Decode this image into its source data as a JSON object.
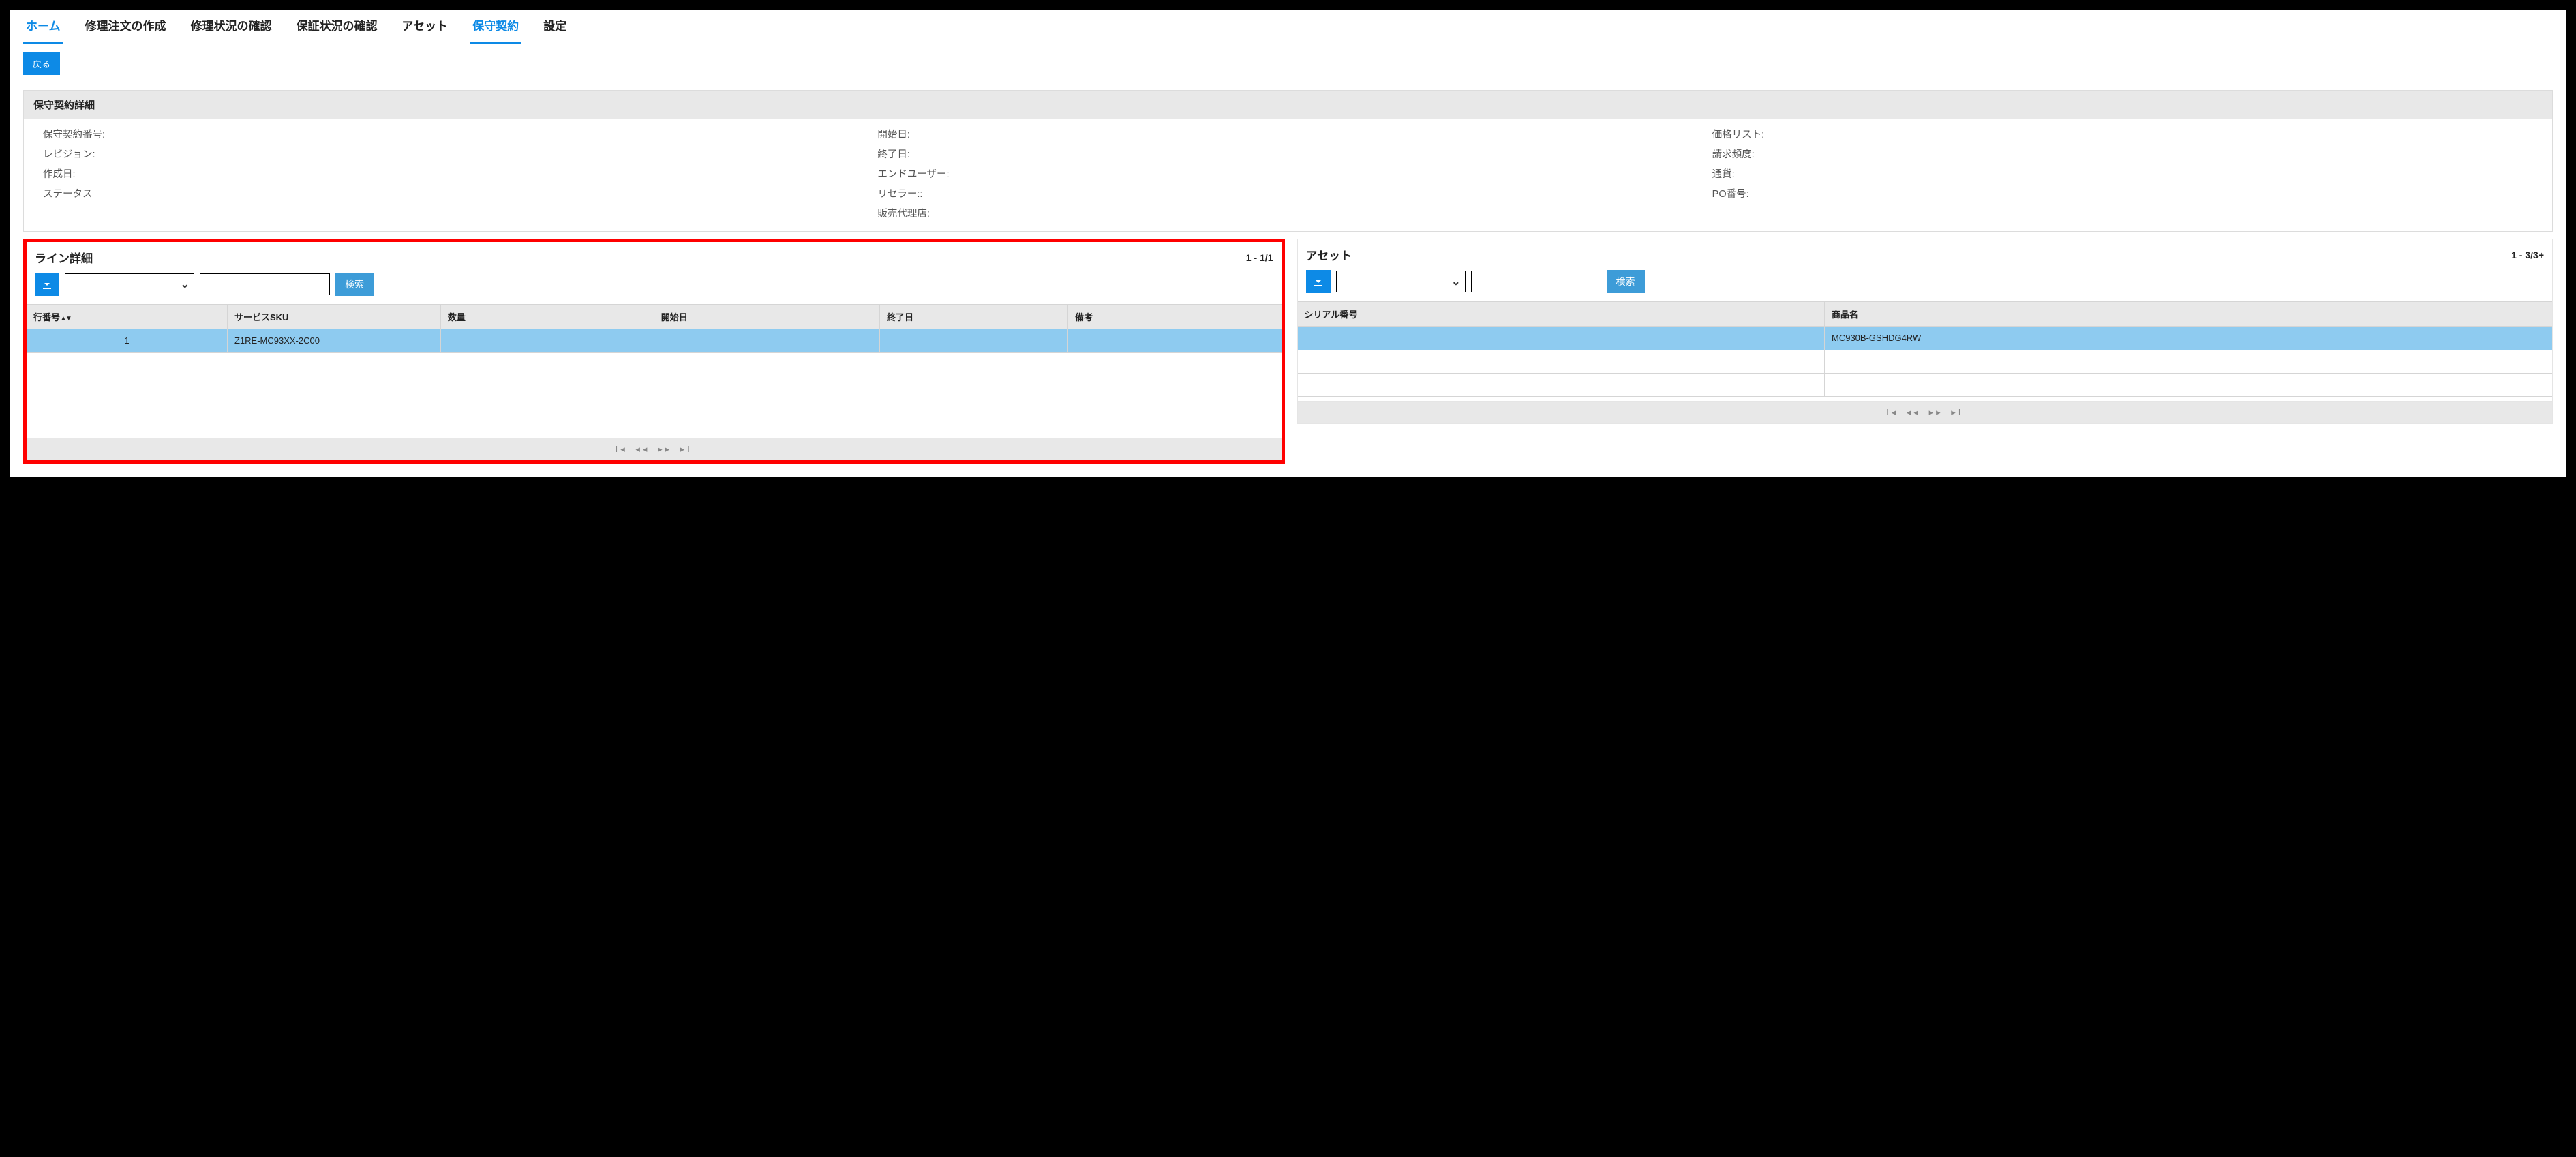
{
  "tabs": {
    "home": "ホーム",
    "create_repair": "修理注文の作成",
    "repair_status": "修理状況の確認",
    "warranty_status": "保証状況の確認",
    "assets": "アセット",
    "contracts": "保守契約",
    "settings": "設定"
  },
  "toolbar": {
    "back": "戻る"
  },
  "detail": {
    "panel_title": "保守契約詳細",
    "col1": {
      "contract_no": "保守契約番号:",
      "revision": "レビジョン:",
      "created": "作成日:",
      "status": "ステータス"
    },
    "col2": {
      "start": "開始日:",
      "end": "終了日:",
      "end_user": "エンドユーザー:",
      "reseller": "リセラー::",
      "distributor": "販売代理店:"
    },
    "col3": {
      "price_list": "価格リスト:",
      "billing_freq": "請求頻度:",
      "currency": "通貨:",
      "po": "PO番号:"
    }
  },
  "lines": {
    "title": "ライン詳細",
    "count": "1 - 1/1",
    "search": "検索",
    "cols": {
      "row_no": "行番号",
      "sku": "サービスSKU",
      "qty": "数量",
      "start": "開始日",
      "end": "終了日",
      "notes": "備考"
    },
    "row1": {
      "no": "1",
      "sku": "Z1RE-MC93XX-2C00",
      "qty": "",
      "start": "",
      "end": "",
      "notes": ""
    }
  },
  "assets_panel": {
    "title": "アセット",
    "count": "1 - 3/3+",
    "search": "検索",
    "cols": {
      "serial": "シリアル番号",
      "product": "商品名"
    },
    "row1": {
      "serial": "",
      "product": "MC930B-GSHDG4RW"
    },
    "row2": {
      "serial": "",
      "product": ""
    },
    "row3": {
      "serial": "",
      "product": ""
    }
  },
  "pager": {
    "first": "⏮",
    "prev": "◀◀",
    "next": "▶▶",
    "last": "⏭"
  }
}
